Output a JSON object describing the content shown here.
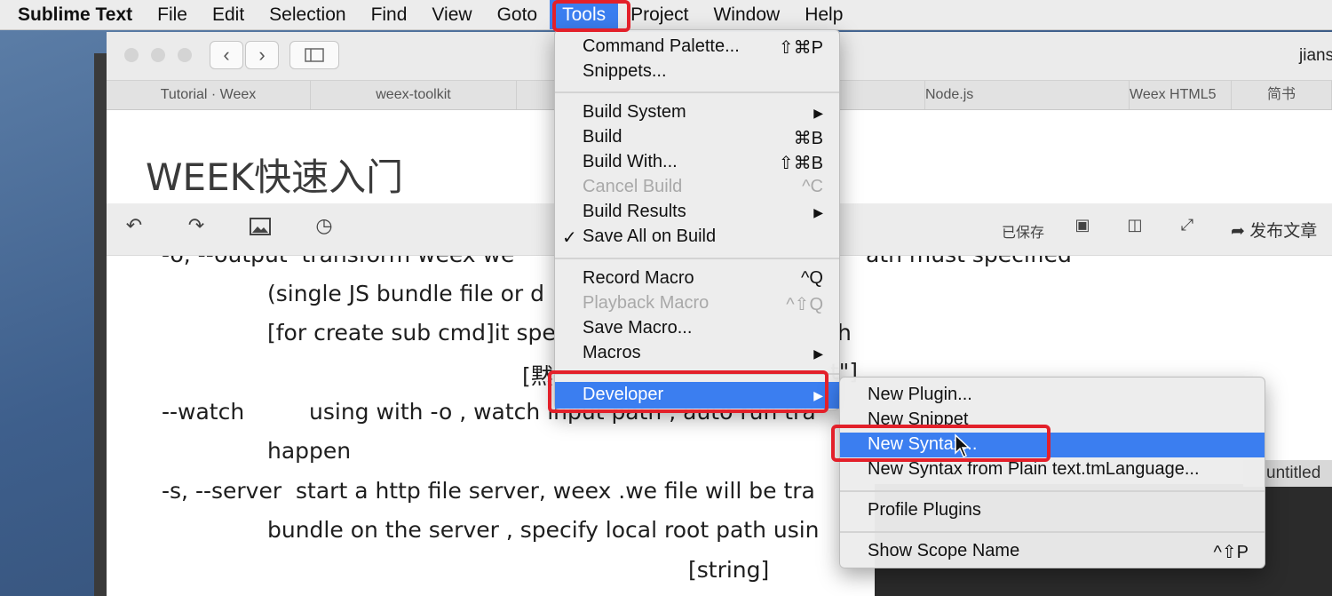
{
  "menubar": {
    "app": "Sublime Text",
    "items": [
      "File",
      "Edit",
      "Selection",
      "Find",
      "View",
      "Goto",
      "Tools",
      "Project",
      "Window",
      "Help"
    ],
    "active": "Tools"
  },
  "browser": {
    "user_fragment": "jians",
    "tabs": [
      "Tutorial · Weex",
      "weex-toolkit",
      "",
      "",
      "Node.js",
      "Weex HTML5",
      "简书"
    ],
    "doc_title": "WEEK快速入门",
    "toolbar": {
      "saved_label": "已保存",
      "publish_label": "发布文章"
    },
    "content_lines": [
      "-o, --output  transform weex we",
      "ath must specified",
      "(single JS bundle file or d",
      "[for create sub cmd]it spe",
      "h",
      "[黙",
      "t\"]",
      "--watch",
      "using with -o , watch input path , auto run tra",
      "happen",
      "-s, --server  start a http file server, weex .we file will be tra",
      "bundle on the server , specify local root path usin",
      "[string]"
    ]
  },
  "untitled_tab": "untitled",
  "tools_menu": {
    "items": [
      {
        "label": "Command Palette...",
        "shortcut": "⇧⌘P"
      },
      {
        "label": "Snippets...",
        "shortcut": ""
      },
      {
        "label": "Build System",
        "shortcut": "▶"
      },
      {
        "label": "Build",
        "shortcut": "⌘B"
      },
      {
        "label": "Build With...",
        "shortcut": "⇧⌘B"
      },
      {
        "label": "Cancel Build",
        "shortcut": "^C",
        "disabled": true
      },
      {
        "label": "Build Results",
        "shortcut": "▶"
      },
      {
        "label": "Save All on Build",
        "shortcut": "",
        "checked": true,
        "check": "✓"
      },
      {
        "label": "Record Macro",
        "shortcut": "^Q"
      },
      {
        "label": "Playback Macro",
        "shortcut": "^⇧Q",
        "disabled": true
      },
      {
        "label": "Save Macro...",
        "shortcut": ""
      },
      {
        "label": "Macros",
        "shortcut": "▶"
      },
      {
        "label": "Developer",
        "shortcut": "▶",
        "highlighted": true
      }
    ]
  },
  "developer_menu": {
    "items": [
      {
        "label": "New Plugin...",
        "shortcut": ""
      },
      {
        "label": "New Snippet",
        "shortcut": ""
      },
      {
        "label": "New Syntax...",
        "shortcut": "",
        "highlighted": true
      },
      {
        "label": "New Syntax from Plain text.tmLanguage...",
        "shortcut": ""
      },
      {
        "label": "Profile Plugins",
        "shortcut": ""
      },
      {
        "label": "Show Scope Name",
        "shortcut": "^⇧P"
      }
    ]
  },
  "colors": {
    "highlight": "#3b7ef0",
    "annotation": "#e3202a"
  }
}
